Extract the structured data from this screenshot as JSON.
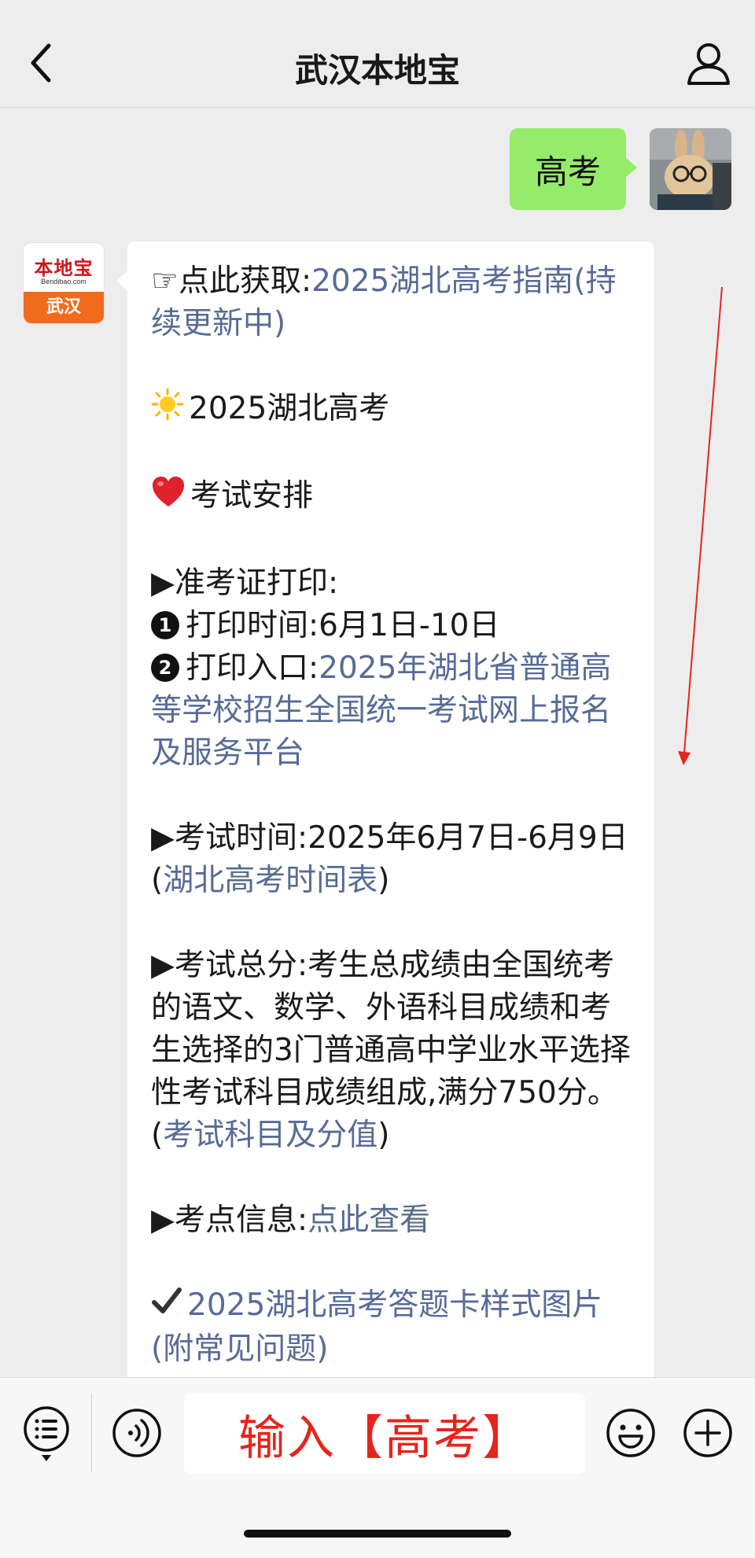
{
  "header": {
    "title": "武汉本地宝",
    "back_icon": "chevron-left-icon",
    "profile_icon": "person-icon"
  },
  "sent_message": {
    "text": "高考"
  },
  "bot": {
    "logo_name": "本地宝",
    "logo_url": "Bendibao.com",
    "logo_city": "武汉"
  },
  "message": {
    "guide_prefix": "☞点此获取:",
    "guide_link": "2025湖北高考指南(持续更新中)",
    "heading_title": "2025湖北高考",
    "arrangement_title": "考试安排",
    "admission_label": "▶准考证打印:",
    "print_time_label": "打印时间:",
    "print_time_value": "6月1日-10日",
    "print_entry_label": "打印入口:",
    "print_entry_link": "2025年湖北省普通高等学校招生全国统一考试网上报名及服务平台",
    "exam_time_label": "▶考试时间:",
    "exam_time_value": "2025年6月7日-6月9日",
    "exam_time_paren_open": "(",
    "exam_time_link": "湖北高考时间表",
    "exam_time_paren_close": ")",
    "total_label": "▶考试总分:",
    "total_text": "考生总成绩由全国统考的语文、数学、外语科目成绩和考生选择的3门普通高中学业水平选择性考试科目成绩组成,满分750分。",
    "total_paren_open": "(",
    "total_link": "考试科目及分值",
    "total_paren_close": ")",
    "venue_label": "▶考点信息:",
    "venue_link": "点此查看",
    "answer_card_link": "2025湖北高考答题卡样式图片(附常见问题)"
  },
  "input": {
    "text": "输入【高考】"
  },
  "colors": {
    "link": "#576b95",
    "sent_bubble": "#95ec69",
    "annotation_red": "#e5251b",
    "background": "#ededed"
  }
}
